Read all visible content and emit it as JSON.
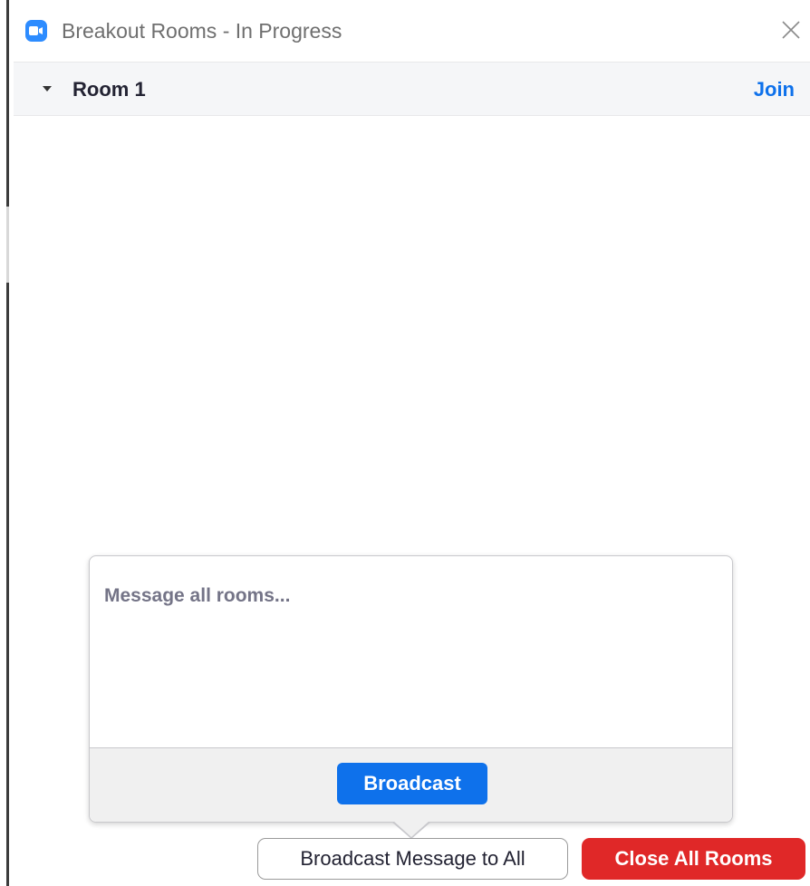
{
  "window": {
    "title": "Breakout Rooms - In Progress"
  },
  "rooms": [
    {
      "name": "Room 1",
      "action_label": "Join"
    }
  ],
  "broadcast_popup": {
    "placeholder": "Message all rooms...",
    "value": "",
    "submit_label": "Broadcast"
  },
  "footer": {
    "broadcast_all_label": "Broadcast Message to All",
    "close_all_label": "Close All Rooms"
  },
  "colors": {
    "accent_blue": "#0e71eb",
    "danger_red": "#e02828",
    "app_icon_blue": "#2d8cff"
  },
  "icons": {
    "app": "zoom-camera-icon",
    "close": "close-icon",
    "caret": "caret-down-icon"
  }
}
